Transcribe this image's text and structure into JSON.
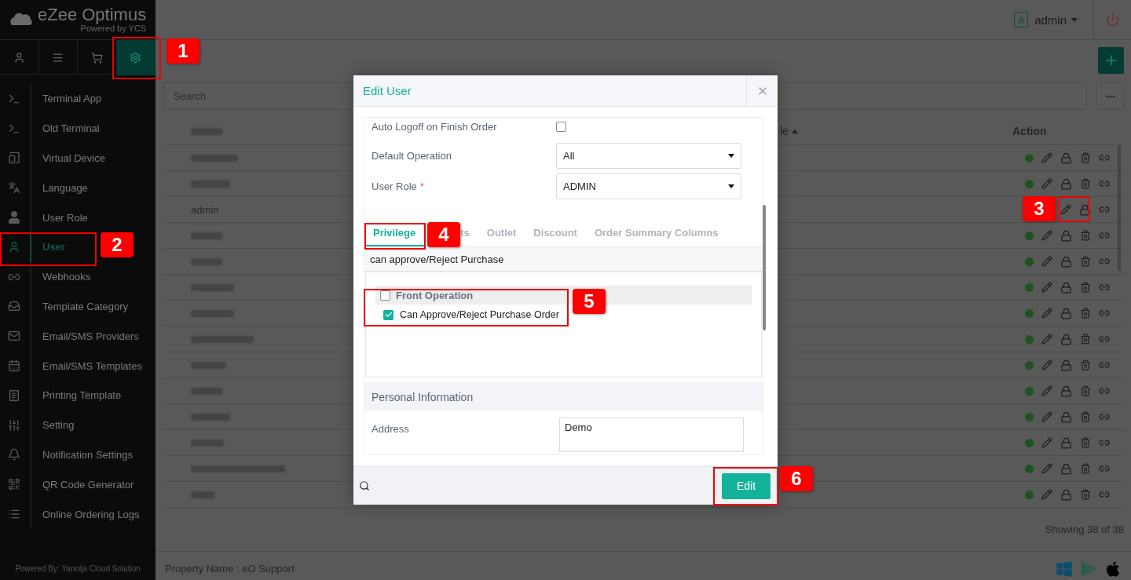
{
  "sidebar": {
    "logo": {
      "title": "eZee Optimus",
      "subtitle": "Powered by YCS"
    },
    "tabs": [
      {
        "selected": false
      },
      {
        "selected": false
      },
      {
        "selected": false
      },
      {
        "selected": true
      }
    ],
    "items": [
      {
        "label": "Terminal App",
        "selected": false
      },
      {
        "label": "Old Terminal",
        "selected": false
      },
      {
        "label": "Virtual Device",
        "selected": false
      },
      {
        "label": "Language",
        "selected": false
      },
      {
        "label": "User Role",
        "selected": false
      },
      {
        "label": "User",
        "selected": true
      },
      {
        "label": "Webhooks",
        "selected": false
      },
      {
        "label": "Template Category",
        "selected": false
      },
      {
        "label": "Email/SMS Providers",
        "selected": false
      },
      {
        "label": "Email/SMS Templates",
        "selected": false
      },
      {
        "label": "Printing Template",
        "selected": false
      },
      {
        "label": "Setting",
        "selected": false
      },
      {
        "label": "Notification Settings",
        "selected": false
      },
      {
        "label": "QR Code Generator",
        "selected": false
      },
      {
        "label": "Online Ordering Logs",
        "selected": false
      }
    ],
    "footer": "Powered By: Yanolja Cloud Solution"
  },
  "topbar": {
    "avatar": "a",
    "user": "admin"
  },
  "search": {
    "placeholder": "Search"
  },
  "table": {
    "columns": [
      "le",
      "Action"
    ],
    "rows": [
      {
        "name": "",
        "status_visible": true,
        "can_delete": true
      },
      {
        "name": "",
        "status_visible": true,
        "can_delete": true
      },
      {
        "name": "admin",
        "can_delete": false
      },
      {
        "name": "",
        "status_visible": true,
        "can_delete": true
      },
      {
        "name": "",
        "status_visible": true,
        "can_delete": true
      },
      {
        "name": "",
        "status_visible": true,
        "can_delete": true
      },
      {
        "name": "",
        "status_visible": true,
        "can_delete": true
      },
      {
        "name": "",
        "status_visible": true,
        "can_delete": true
      },
      {
        "name": "",
        "status_visible": true,
        "can_delete": true
      },
      {
        "name": "",
        "status_visible": true,
        "can_delete": true
      },
      {
        "name": "",
        "status_visible": true,
        "can_delete": true
      },
      {
        "name": "",
        "status_visible": true,
        "can_delete": true
      },
      {
        "name": "",
        "status_visible": true,
        "can_delete": true
      },
      {
        "name": "",
        "status_visible": true,
        "can_delete": true
      }
    ],
    "footer": "Showing 38 of 38"
  },
  "bottom_bar": {
    "property": "Property Name : eO Support"
  },
  "modal": {
    "title": "Edit User",
    "auto_logoff": {
      "label": "Auto Logoff on Finish Order",
      "checked": false
    },
    "default_operation": {
      "label": "Default Operation",
      "value": "All"
    },
    "user_role": {
      "label": "User Role",
      "required": "*",
      "value": "ADMIN"
    },
    "tabs": [
      {
        "label": "Privilege",
        "selected": true
      },
      {
        "label": "ts",
        "selected": false,
        "kind": "partial"
      },
      {
        "label": "Outlet",
        "selected": false
      },
      {
        "label": "Discount",
        "selected": false
      },
      {
        "label": "Order Summary Columns",
        "selected": false
      }
    ],
    "privilege_search": {
      "value": "can approve/Reject Purchase"
    },
    "tree": [
      {
        "label": "Front Operation",
        "checked": false,
        "children": [
          {
            "label": "Can Approve/Reject Purchase Order",
            "checked": true
          }
        ]
      }
    ],
    "section": "Personal Information",
    "address": {
      "label": "Address",
      "value": "Demo"
    },
    "submit": "Edit"
  },
  "annotations": [
    {
      "number": "1"
    },
    {
      "number": "2"
    },
    {
      "number": "3"
    },
    {
      "number": "4"
    },
    {
      "number": "5"
    },
    {
      "number": "6"
    }
  ]
}
